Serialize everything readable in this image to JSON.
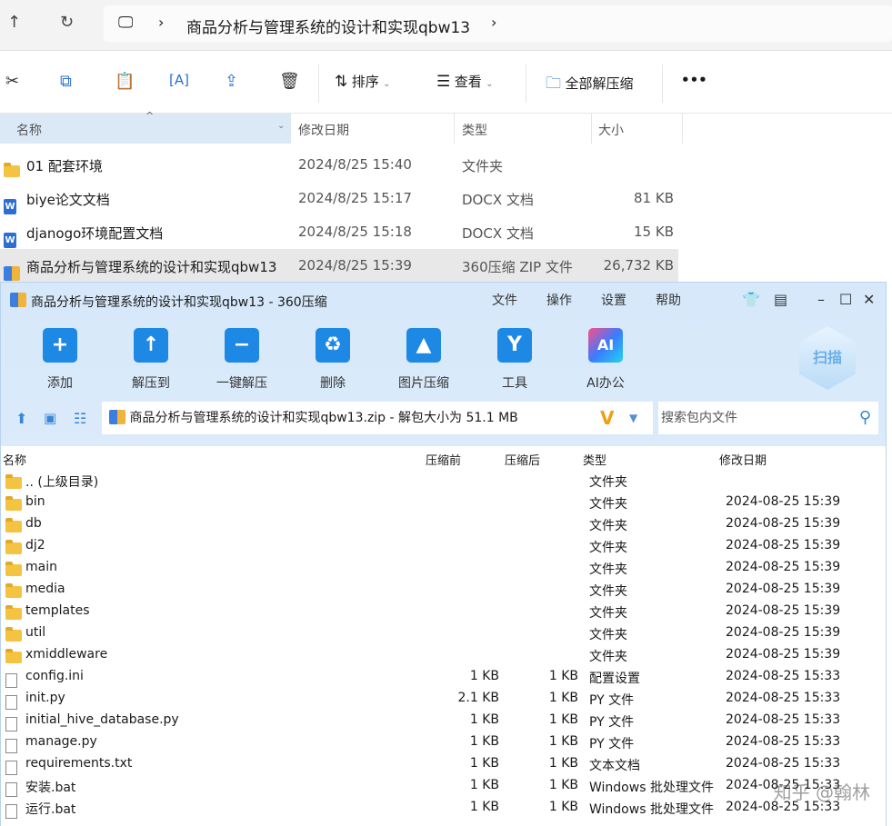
{
  "explorer": {
    "breadcrumb": "商品分析与管理系统的设计和实现qbw13",
    "toolbar": {
      "sort": "排序",
      "view": "查看",
      "extract_all": "全部解压缩",
      "more": "•••"
    },
    "columns": [
      "名称",
      "修改日期",
      "类型",
      "大小"
    ],
    "rows": [
      {
        "icon": "folder",
        "name": "01 配套环境",
        "date": "2024/8/25 15:40",
        "type": "文件夹",
        "size": ""
      },
      {
        "icon": "word",
        "name": "biye论文文档",
        "date": "2024/8/25 15:17",
        "type": "DOCX 文档",
        "size": "81 KB"
      },
      {
        "icon": "word",
        "name": "djanogo环境配置文档",
        "date": "2024/8/25 15:18",
        "type": "DOCX 文档",
        "size": "15 KB"
      },
      {
        "icon": "zip",
        "name": "商品分析与管理系统的设计和实现qbw13",
        "date": "2024/8/25 15:39",
        "type": "360压缩 ZIP 文件",
        "size": "26,732 KB"
      }
    ]
  },
  "zip": {
    "title": "商品分析与管理系统的设计和实现qbw13 - 360压缩",
    "menu": [
      "文件",
      "操作",
      "设置",
      "帮助"
    ],
    "tools": [
      "添加",
      "解压到",
      "一键解压",
      "删除",
      "图片压缩",
      "工具",
      "AI办公"
    ],
    "scan": "扫描",
    "path": "商品分析与管理系统的设计和实现qbw13.zip - 解包大小为 51.1 MB",
    "search_placeholder": "搜索包内文件",
    "columns": [
      "名称",
      "压缩前",
      "压缩后",
      "类型",
      "修改日期"
    ],
    "rows": [
      {
        "icon": "folder",
        "name": ".. (上级目录)",
        "before": "",
        "after": "",
        "type": "文件夹",
        "date": ""
      },
      {
        "icon": "folder",
        "name": "bin",
        "before": "",
        "after": "",
        "type": "文件夹",
        "date": "2024-08-25 15:39"
      },
      {
        "icon": "folder",
        "name": "db",
        "before": "",
        "after": "",
        "type": "文件夹",
        "date": "2024-08-25 15:39"
      },
      {
        "icon": "folder",
        "name": "dj2",
        "before": "",
        "after": "",
        "type": "文件夹",
        "date": "2024-08-25 15:39"
      },
      {
        "icon": "folder",
        "name": "main",
        "before": "",
        "after": "",
        "type": "文件夹",
        "date": "2024-08-25 15:39"
      },
      {
        "icon": "folder",
        "name": "media",
        "before": "",
        "after": "",
        "type": "文件夹",
        "date": "2024-08-25 15:39"
      },
      {
        "icon": "folder",
        "name": "templates",
        "before": "",
        "after": "",
        "type": "文件夹",
        "date": "2024-08-25 15:39"
      },
      {
        "icon": "folder",
        "name": "util",
        "before": "",
        "after": "",
        "type": "文件夹",
        "date": "2024-08-25 15:39"
      },
      {
        "icon": "folder",
        "name": "xmiddleware",
        "before": "",
        "after": "",
        "type": "文件夹",
        "date": "2024-08-25 15:39"
      },
      {
        "icon": "file",
        "name": "config.ini",
        "before": "1 KB",
        "after": "1 KB",
        "type": "配置设置",
        "date": "2024-08-25 15:33"
      },
      {
        "icon": "file",
        "name": "init.py",
        "before": "2.1 KB",
        "after": "1 KB",
        "type": "PY 文件",
        "date": "2024-08-25 15:33"
      },
      {
        "icon": "file",
        "name": "initial_hive_database.py",
        "before": "1 KB",
        "after": "1 KB",
        "type": "PY 文件",
        "date": "2024-08-25 15:33"
      },
      {
        "icon": "file",
        "name": "manage.py",
        "before": "1 KB",
        "after": "1 KB",
        "type": "PY 文件",
        "date": "2024-08-25 15:33"
      },
      {
        "icon": "file",
        "name": "requirements.txt",
        "before": "1 KB",
        "after": "1 KB",
        "type": "文本文档",
        "date": "2024-08-25 15:33"
      },
      {
        "icon": "file",
        "name": "安装.bat",
        "before": "1 KB",
        "after": "1 KB",
        "type": "Windows 批处理文件",
        "date": "2024-08-25 15:33"
      },
      {
        "icon": "file",
        "name": "运行.bat",
        "before": "1 KB",
        "after": "1 KB",
        "type": "Windows 批处理文件",
        "date": "2024-08-25 15:33"
      }
    ]
  },
  "watermark": "知乎 @翰林"
}
